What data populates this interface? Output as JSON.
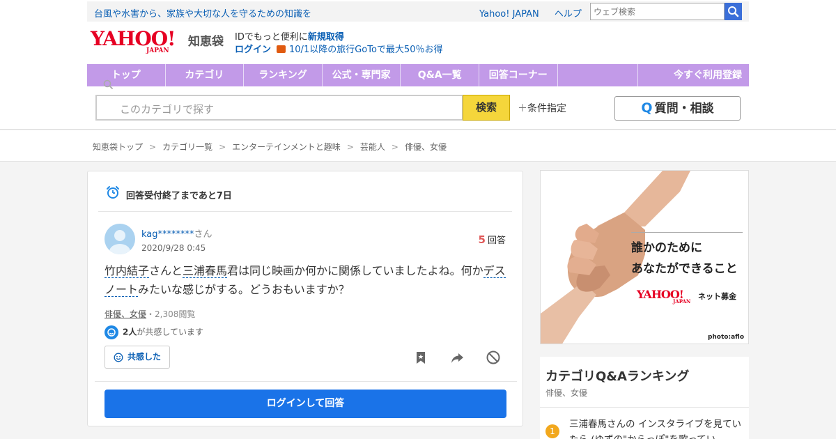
{
  "topbar": {
    "tagline": "台風や水害から、家族や大切な人を守るための知識を",
    "links": [
      "Yahoo! JAPAN",
      "ヘルプ"
    ],
    "websearch_placeholder": "ウェブ検索"
  },
  "header": {
    "logo_main": "YAHOO!",
    "logo_sub": "JAPAN",
    "service_name": "知恵袋",
    "id_text": "IDでもっと便利に",
    "id_link": "新規取得",
    "login": "ログイン",
    "promo": "10/1以降の旅行GoToで最大50％お得"
  },
  "nav": {
    "items": [
      "トップ",
      "カテゴリ",
      "ランキング",
      "公式・専門家",
      "Q&A一覧",
      "回答コーナー"
    ],
    "register": "今すぐ利用登録"
  },
  "search": {
    "placeholder": "このカテゴリで探す",
    "button": "検索",
    "condition": "条件指定",
    "ask_q": "Q",
    "ask": "質問・相談"
  },
  "breadcrumb": [
    "知恵袋トップ",
    "カテゴリ一覧",
    "エンターテインメントと趣味",
    "芸能人",
    "俳優、女優"
  ],
  "question": {
    "deadline": "回答受付終了まであと7日",
    "username": "kag********",
    "honorific": "さん",
    "date": "2020/9/28 0:45",
    "answer_count": "5",
    "answer_label": "回答",
    "body_parts": [
      "竹内結子",
      "さんと",
      "三浦春馬",
      "君は同じ映画か何かに関係していましたよね。何か",
      "デスノート",
      "みたいな感じがする。どうおもいますか？"
    ],
    "category": "俳優、女優",
    "views": "・2,308閲覧",
    "empathy_count": "2人",
    "empathy_text": "が共感しています",
    "empathy_button": "共感した",
    "answer_button": "ログインして回答"
  },
  "ad": {
    "line1": "誰かのために",
    "line2": "あなたができること",
    "logo_main": "YAHOO!",
    "logo_sub": "JAPAN",
    "service": "ネット募金",
    "credit": "photo:aflo"
  },
  "ranking": {
    "title": "カテゴリQ&Aランキング",
    "subtitle": "俳優、女優",
    "first_rank": "1",
    "first_item": "三浦春馬さんの インスタライブを見ていたら (ゆずの\"からっぽ\"を歌ってい"
  },
  "colors": {
    "nav_purple": "#c29ae8",
    "link_blue": "#0a5fb4",
    "search_yellow": "#f5d63b",
    "answer_blue": "#1a73e8",
    "yahoo_red": "#e60023",
    "rank_orange": "#f2a81d"
  }
}
